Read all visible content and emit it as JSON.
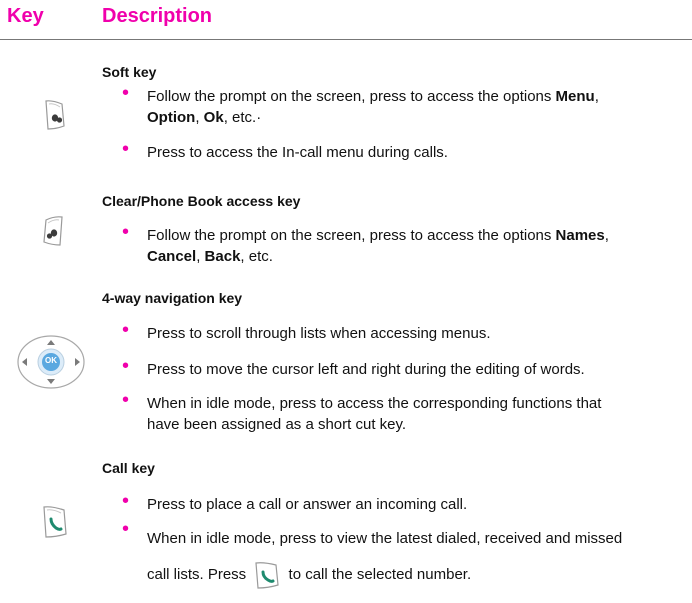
{
  "header": {
    "key_label": "Key",
    "description_label": "Description"
  },
  "sections": [
    {
      "title": "Soft key",
      "icon": "soft-key-icon",
      "bullets": [
        {
          "a": "Follow the prompt on the screen, press to access the options ",
          "b1": "Menu",
          "c": ",",
          "d": "Option",
          "e": ", ",
          "f": "Ok",
          "g": ", etc.·"
        },
        {
          "text": "Press to access the In-call menu during calls."
        }
      ]
    },
    {
      "title": "Clear/Phone Book access key",
      "icon": "clear-key-icon",
      "bullets": [
        {
          "a": "Follow the prompt on the screen, press to access the options ",
          "b1": "Names",
          "c": ",",
          "d": "Cancel",
          "e": ", ",
          "f": "Back",
          "g": ", etc."
        }
      ]
    },
    {
      "title": "4-way navigation key",
      "icon": "navigation-key-icon",
      "ok_label": "OK",
      "bullets": [
        {
          "text": "Press to scroll through lists when accessing menus."
        },
        {
          "text": "Press to move the cursor left and right during the editing of words."
        },
        {
          "line1": "When in idle mode, press to access the corresponding functions that",
          "line2": "have been assigned as a short cut key."
        }
      ]
    },
    {
      "title": "Call key",
      "icon": "call-key-icon",
      "bullets": [
        {
          "text": "Press to place a call or answer an incoming call."
        },
        {
          "line1": "When in idle mode, press to view the latest dialed, received and missed",
          "line2a": "call lists. Press ",
          "line2b": " to call the selected number."
        }
      ]
    }
  ],
  "colors": {
    "accent": "#f000ac",
    "call_green": "#1e8a6e",
    "nav_blue": "#5aa8e0"
  }
}
